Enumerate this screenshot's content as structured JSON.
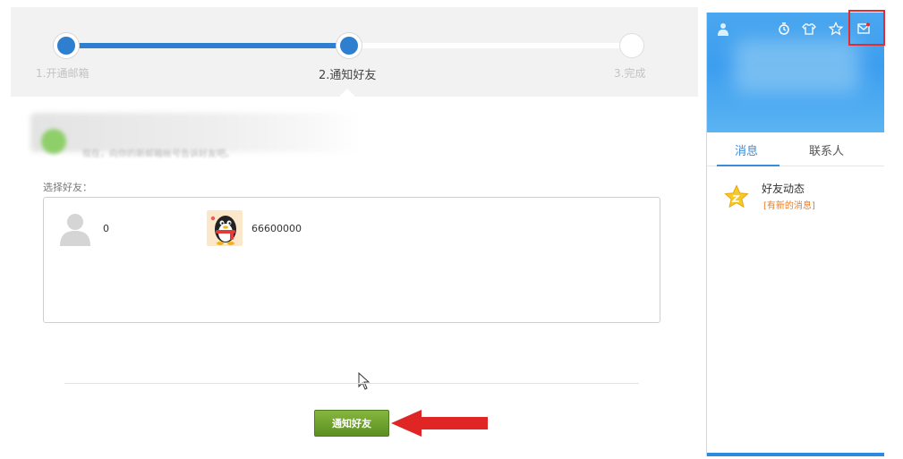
{
  "wizard": {
    "steps": [
      {
        "label": "1.开通邮箱",
        "state": "done"
      },
      {
        "label": "2.通知好友",
        "state": "current"
      },
      {
        "label": "3.完成",
        "state": "todo"
      }
    ],
    "progress_fraction": 0.5,
    "hint_text": "现在，向你的新邮箱帐号告诉好友吧。",
    "select_label": "选择好友：",
    "friends": [
      {
        "name": "0",
        "avatar": "default-avatar-icon"
      },
      {
        "name": "66600000",
        "avatar": "penguin-avatar-icon"
      }
    ],
    "notify_button_label": "通知好友"
  },
  "panel": {
    "tabs": [
      {
        "label": "消息",
        "active": true
      },
      {
        "label": "联系人",
        "active": false
      }
    ],
    "feed": {
      "title": "好友动态",
      "subtitle": "[有新的消息]",
      "icon": "star-icon"
    },
    "header_icons": [
      "clock-icon",
      "shirt-icon",
      "star-outline-icon",
      "mail-icon"
    ]
  },
  "colors": {
    "progress_blue": "#2f7fd1",
    "button_green": "#6aa22c",
    "panel_blue": "#3d9eef",
    "tab_blue": "#3a8bd8",
    "notice_orange": "#f07a1a",
    "highlight_red": "#e52b2b"
  }
}
